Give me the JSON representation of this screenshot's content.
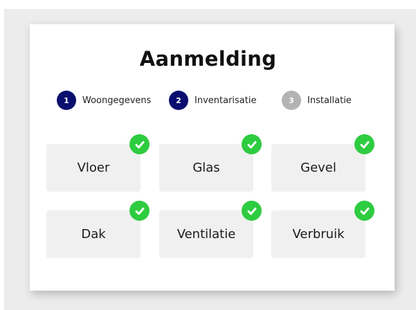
{
  "page": {
    "title": "Aanmelding"
  },
  "steps": [
    {
      "number": "1",
      "label": "Woongegevens",
      "state": "completed",
      "color": "#0a0e6e"
    },
    {
      "number": "2",
      "label": "Inventarisatie",
      "state": "active",
      "color": "#0a0e6e"
    },
    {
      "number": "3",
      "label": "Installatie",
      "state": "inactive",
      "color": "#b3b3b3"
    }
  ],
  "categories": [
    {
      "label": "Vloer",
      "checked": true
    },
    {
      "label": "Glas",
      "checked": true
    },
    {
      "label": "Gevel",
      "checked": true
    },
    {
      "label": "Dak",
      "checked": true
    },
    {
      "label": "Ventilatie",
      "checked": true
    },
    {
      "label": "Verbruik",
      "checked": true
    }
  ],
  "icons": {
    "check": "check-circle-icon"
  },
  "colors": {
    "check": "#2ecc40",
    "tile_background": "#f0f0f0",
    "step_active": "#0a0e6e",
    "step_inactive": "#b3b3b3"
  }
}
